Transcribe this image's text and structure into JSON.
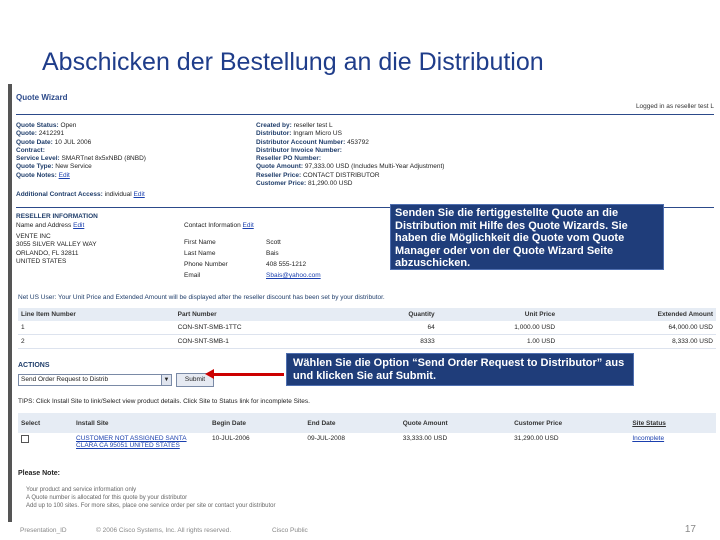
{
  "slide_title": "Abschicken der Bestellung an die Distribution",
  "screenshot": {
    "wizard_title": "Quote Wizard",
    "logged_in": "Logged in as reseller test L",
    "left_fields": [
      {
        "label": "Quote Status:",
        "value": "Open"
      },
      {
        "label": "Quote:",
        "value": "2412291"
      },
      {
        "label": "Quote Date:",
        "value": "10 JUL 2006"
      },
      {
        "label": "Contract:",
        "value": ""
      },
      {
        "label": "Service Level:",
        "value": "SMARTnet 8x5xNBD (8NBD)"
      },
      {
        "label": "Quote Type:",
        "value": "New Service"
      },
      {
        "label": "Quote Notes:",
        "value": "Edit"
      }
    ],
    "right_fields": [
      {
        "label": "Created by:",
        "value": "reseller test L"
      },
      {
        "label": "Distributor:",
        "value": "Ingram Micro US"
      },
      {
        "label": "Distributor Account Number:",
        "value": "453792"
      },
      {
        "label": "Distributor Invoice Number:",
        "value": ""
      },
      {
        "label": "Reseller PO Number:",
        "value": ""
      },
      {
        "label": "Quote Amount:",
        "value": "97,333.00 USD (Includes Multi-Year Adjustment)"
      },
      {
        "label": "Reseller Price:",
        "value": "CONTACT DISTRIBUTOR"
      },
      {
        "label": "Customer Price:",
        "value": "81,290.00 USD"
      }
    ],
    "contract_access": {
      "label": "Additional Contract Access:",
      "value": "individual",
      "link": "Edit"
    },
    "reseller_info": {
      "heading": "RESELLER INFORMATION",
      "name_address_label": "Name and Address",
      "name_address_link": "Edit",
      "contact_label": "Contact Information",
      "contact_link": "Edit",
      "address_lines": [
        "VENTE INC",
        "3055 SILVER VALLEY WAY",
        "ORLANDO, FL 32811",
        "UNITED STATES"
      ],
      "contact": [
        {
          "label": "First Name",
          "value": "Scott"
        },
        {
          "label": "Last Name",
          "value": "Bais"
        },
        {
          "label": "Phone Number",
          "value": "408 555-1212"
        },
        {
          "label": "Email",
          "value": "Sbais@yahoo.com"
        }
      ]
    },
    "unit_price_note": "Net US User: Your Unit Price and Extended Amount will be displayed after the reseller discount has been set by your distributor.",
    "lines_table": {
      "headers": [
        "Line Item Number",
        "Part Number",
        "Quantity",
        "Unit Price",
        "Extended Amount"
      ],
      "rows": [
        [
          "1",
          "CON-SNT-SMB-1TTC",
          "64",
          "1,000.00 USD",
          "64,000.00 USD"
        ],
        [
          "2",
          "CON-SNT-SMB-1",
          "8333",
          "1.00 USD",
          "8,333.00 USD"
        ]
      ]
    },
    "actions": {
      "heading": "ACTIONS",
      "select_value": "Send Order Request to Distrib",
      "submit_label": "Submit"
    },
    "tips": "TIPS: Click Install Site to link/Select view product details. Click Site to Status link for incomplete Sites.",
    "sites_table": {
      "headers": [
        "Select",
        "Install Site",
        "Begin Date",
        "End Date",
        "Quote Amount",
        "Customer Price",
        "Site Status"
      ],
      "rows": [
        [
          "",
          "CUSTOMER NOT ASSIGNED SANTA CLARA CA 95051 UNITED STATES",
          "10-JUL-2006",
          "09-JUL-2008",
          "33,333.00 USD",
          "31,290.00 USD",
          "Incomplete"
        ]
      ]
    },
    "please_note": {
      "heading": "Please Note:",
      "lines": [
        "Your product and service information only",
        "A Quote number is allocated for this quote by your distributor",
        "Add up to 100 sites. For more sites, place one service order per site or contact your distributor"
      ]
    }
  },
  "callouts": {
    "callout1": "Senden Sie die fertiggestellte Quote an die Distribution mit Hilfe des Quote Wizards. Sie haben die Möglichkeit die Quote vom Quote Manager oder von der Quote Wizard Seite abzuschicken.",
    "callout2": "Wählen Sie die Option “Send Order Request to Distributor” aus und klicken Sie auf Submit."
  },
  "footer": {
    "left": "Presentation_ID",
    "copyright": "© 2006 Cisco Systems, Inc. All rights reserved.",
    "center": "Cisco Public",
    "page": "17"
  },
  "colors": {
    "title": "#1f3d8a",
    "callout_bg": "#1f3d7a",
    "arrow": "#cc0000"
  }
}
